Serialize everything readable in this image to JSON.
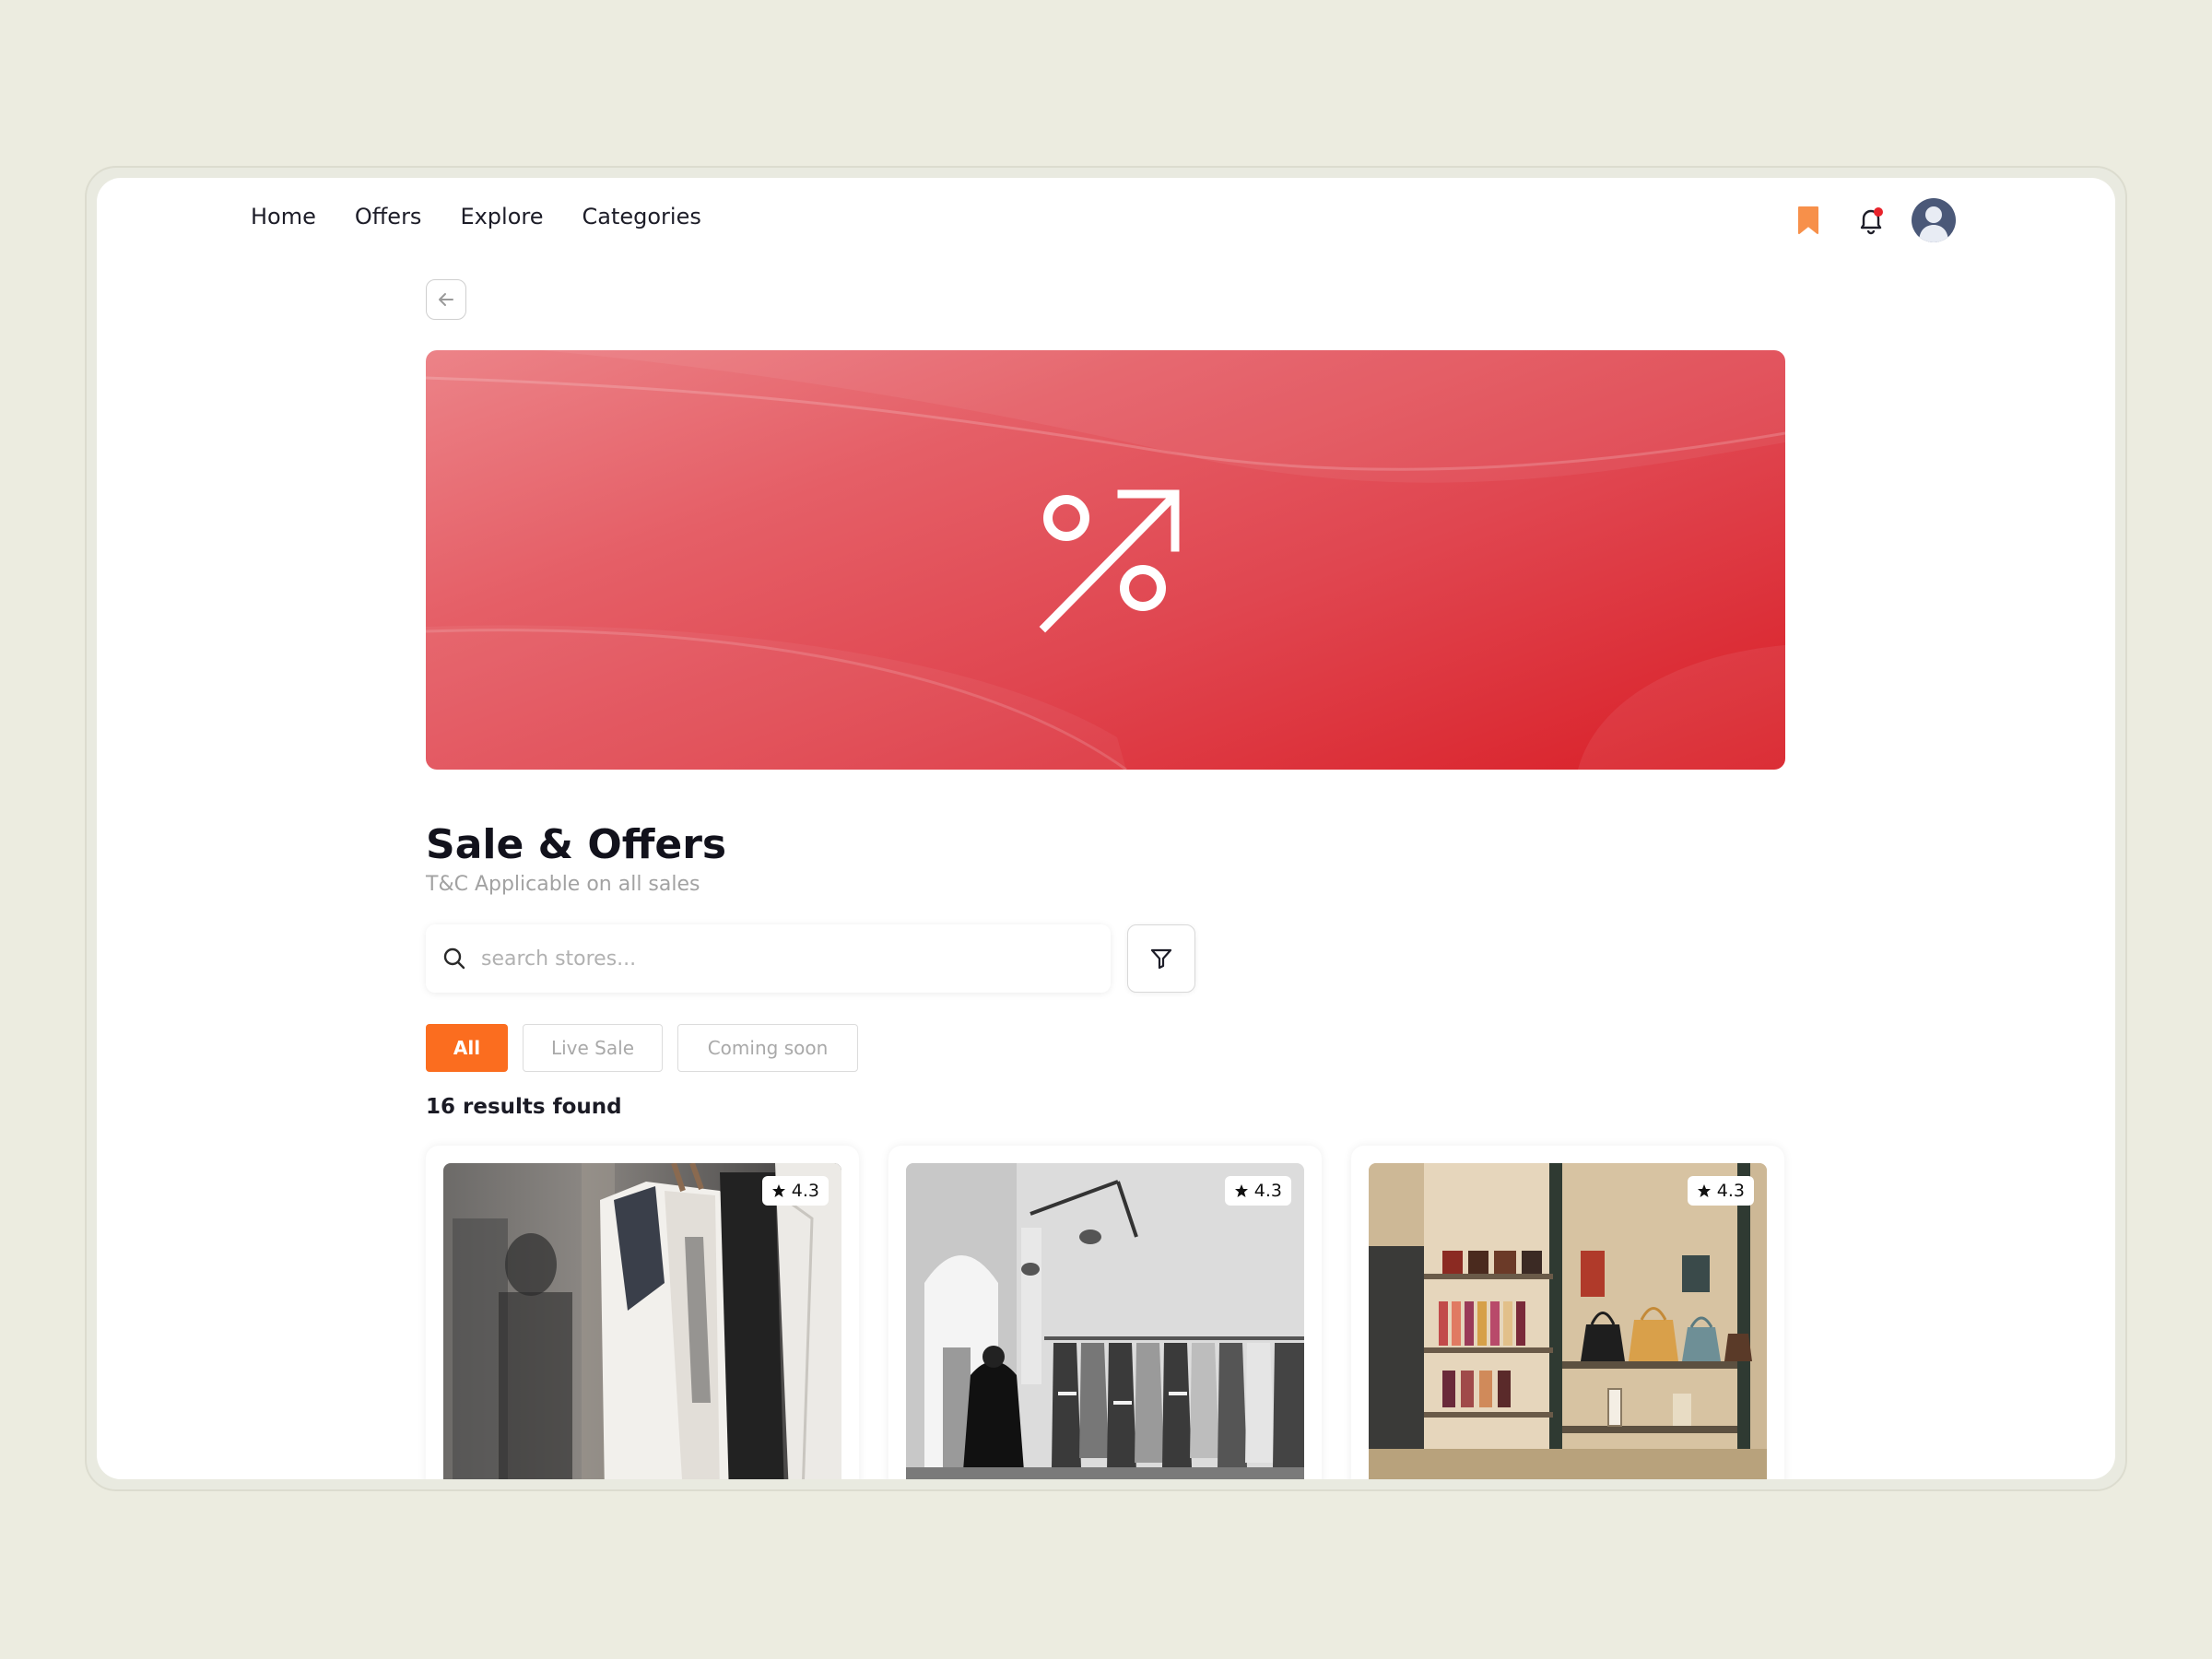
{
  "nav": {
    "links": [
      "Home",
      "Offers",
      "Explore",
      "Categories"
    ]
  },
  "icons": {
    "bookmark": "bookmark-icon",
    "notification": "bell-icon",
    "avatar": "user-avatar"
  },
  "colors": {
    "accent": "#fb6d1f",
    "banner_red": "#d91f27",
    "notification_dot": "#e8232b",
    "bookmark": "#f7904a"
  },
  "page": {
    "title": "Sale & Offers",
    "subtitle": "T&C Applicable on all sales"
  },
  "search": {
    "placeholder": "search stores..."
  },
  "filters": {
    "chips": [
      "All",
      "Live Sale",
      "Coming soon"
    ],
    "active": "All"
  },
  "results": {
    "text": "16 results found"
  },
  "stores": [
    {
      "rating": "4.3"
    },
    {
      "rating": "4.3"
    },
    {
      "rating": "4.3"
    }
  ]
}
